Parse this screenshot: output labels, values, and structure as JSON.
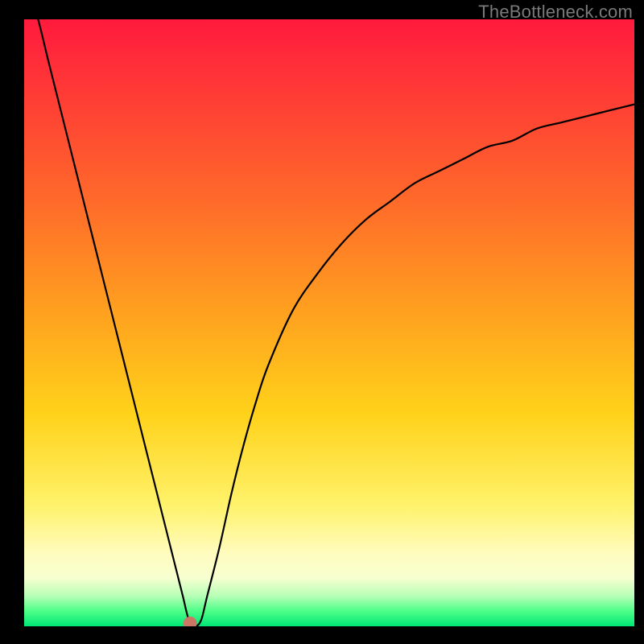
{
  "watermark": {
    "text": "TheBottleneck.com"
  },
  "chart_data": {
    "type": "line",
    "title": "",
    "xlabel": "",
    "ylabel": "",
    "xlim": [
      0,
      100
    ],
    "ylim": [
      0,
      100
    ],
    "series": [
      {
        "name": "bottleneck-curve",
        "x": [
          0,
          2,
          4,
          6,
          8,
          10,
          12,
          14,
          16,
          18,
          20,
          22,
          24,
          25,
          26,
          27,
          28,
          29,
          30,
          32,
          34,
          36,
          38,
          40,
          44,
          48,
          52,
          56,
          60,
          64,
          68,
          72,
          76,
          80,
          84,
          88,
          92,
          96,
          100
        ],
        "y": [
          106,
          101,
          93,
          85,
          77,
          69,
          61,
          53,
          45,
          37,
          29,
          21,
          13,
          9,
          5,
          1,
          0,
          1,
          5,
          13,
          22,
          30,
          37,
          43,
          52,
          58,
          63,
          67,
          70,
          73,
          75,
          77,
          79,
          80,
          82,
          83,
          84,
          85,
          86
        ]
      }
    ],
    "marker": {
      "x": 27.2,
      "y": 0.5,
      "color": "#cc7766",
      "radius_pct": 1.1
    },
    "background_gradient": {
      "stops": [
        {
          "pos": 0.0,
          "color": "#ff1a3d"
        },
        {
          "pos": 0.3,
          "color": "#ff6a2a"
        },
        {
          "pos": 0.65,
          "color": "#ffd21a"
        },
        {
          "pos": 0.88,
          "color": "#fffcbe"
        },
        {
          "pos": 0.97,
          "color": "#4dff88"
        },
        {
          "pos": 1.0,
          "color": "#00e676"
        }
      ]
    }
  }
}
